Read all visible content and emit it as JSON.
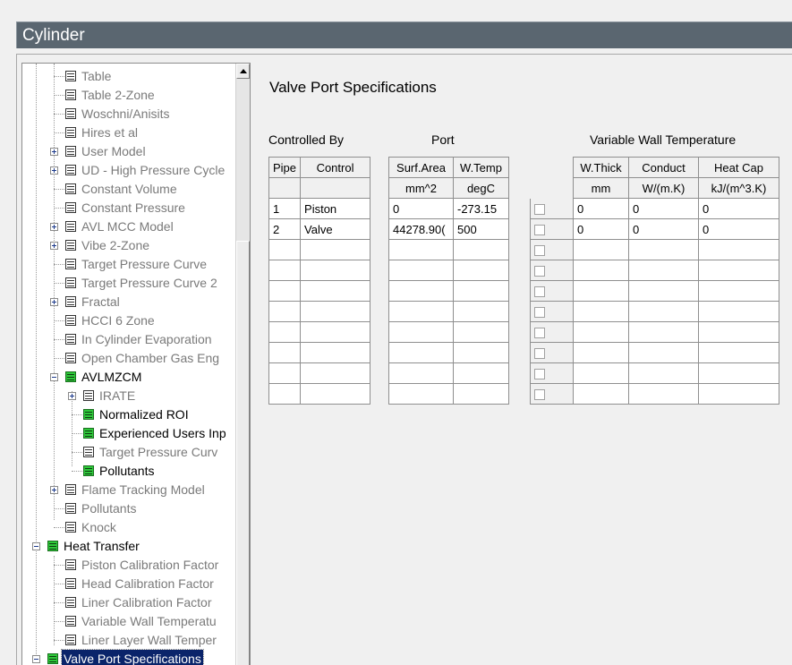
{
  "window": {
    "title": "Cylinder"
  },
  "tree": {
    "items": [
      {
        "label": "Table"
      },
      {
        "label": "Table 2-Zone"
      },
      {
        "label": "Woschni/Anisits"
      },
      {
        "label": "Hires et al"
      },
      {
        "label": "User Model"
      },
      {
        "label": "UD - High Pressure Cycle"
      },
      {
        "label": "Constant Volume"
      },
      {
        "label": "Constant Pressure"
      },
      {
        "label": "AVL MCC Model"
      },
      {
        "label": "Vibe 2-Zone"
      },
      {
        "label": "Target Pressure Curve"
      },
      {
        "label": "Target Pressure Curve 2"
      },
      {
        "label": "Fractal"
      },
      {
        "label": "HCCI 6 Zone"
      },
      {
        "label": "In Cylinder Evaporation"
      },
      {
        "label": "Open Chamber Gas Eng"
      },
      {
        "label": "AVLMZCM"
      },
      {
        "label": "IRATE"
      },
      {
        "label": "Normalized ROI"
      },
      {
        "label": "Experienced Users Inp"
      },
      {
        "label": "Target Pressure Curv"
      },
      {
        "label": "Pollutants"
      },
      {
        "label": "Flame Tracking Model"
      },
      {
        "label": "Pollutants"
      },
      {
        "label": "Knock"
      },
      {
        "label": "Heat Transfer"
      },
      {
        "label": "Piston Calibration Factor"
      },
      {
        "label": "Head Calibration Factor"
      },
      {
        "label": "Liner Calibration Factor"
      },
      {
        "label": "Variable Wall Temperatu"
      },
      {
        "label": "Liner Layer Wall Temper"
      },
      {
        "label": "Valve Port Specifications"
      }
    ]
  },
  "main": {
    "heading": "Valve Port Specifications",
    "groups": {
      "controlled_by": "Controlled By",
      "port": "Port",
      "variable_wall": "Variable Wall Temperature"
    },
    "left_table": {
      "headers": [
        "Pipe",
        "Control"
      ],
      "units": [
        "",
        ""
      ],
      "rows": [
        [
          "1",
          "Piston"
        ],
        [
          "2",
          "Valve"
        ],
        [
          "",
          ""
        ],
        [
          "",
          ""
        ],
        [
          "",
          ""
        ],
        [
          "",
          ""
        ],
        [
          "",
          ""
        ],
        [
          "",
          ""
        ],
        [
          "",
          ""
        ],
        [
          "",
          ""
        ]
      ]
    },
    "port_table": {
      "headers": [
        "Surf.Area",
        "W.Temp"
      ],
      "units": [
        "mm^2",
        "degC"
      ],
      "rows": [
        [
          "0",
          "-273.15"
        ],
        [
          "44278.90(",
          "500"
        ],
        [
          "",
          ""
        ],
        [
          "",
          ""
        ],
        [
          "",
          ""
        ],
        [
          "",
          ""
        ],
        [
          "",
          ""
        ],
        [
          "",
          ""
        ],
        [
          "",
          ""
        ],
        [
          "",
          ""
        ]
      ]
    },
    "wall_table": {
      "headers": [
        "W.Thick",
        "Conduct",
        "Heat Cap"
      ],
      "units": [
        "mm",
        "W/(m.K)",
        "kJ/(m^3.K)"
      ],
      "rows": [
        [
          "0",
          "0",
          "0"
        ],
        [
          "0",
          "0",
          "0"
        ],
        [
          "",
          "",
          ""
        ],
        [
          "",
          "",
          ""
        ],
        [
          "",
          "",
          ""
        ],
        [
          "",
          "",
          ""
        ],
        [
          "",
          "",
          ""
        ],
        [
          "",
          "",
          ""
        ],
        [
          "",
          "",
          ""
        ],
        [
          "",
          "",
          ""
        ]
      ]
    }
  }
}
